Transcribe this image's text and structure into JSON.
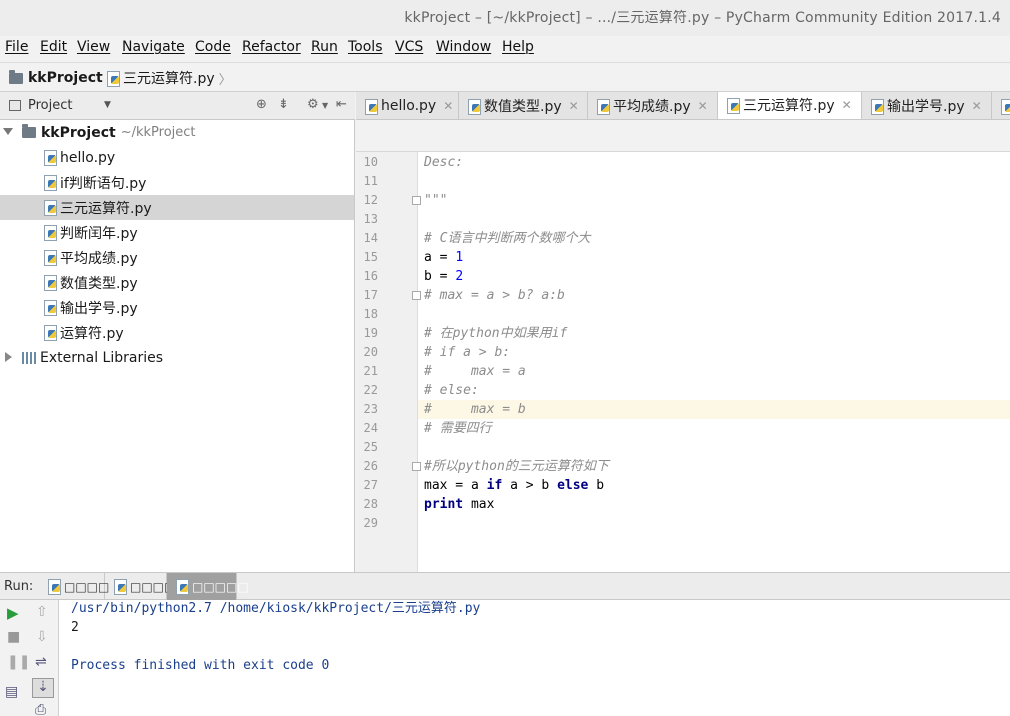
{
  "window": {
    "title": "kkProject – [~/kkProject] – .../三元运算符.py – PyCharm Community Edition 2017.1.4"
  },
  "menu": [
    "File",
    "Edit",
    "View",
    "Navigate",
    "Code",
    "Refactor",
    "Run",
    "Tools",
    "VCS",
    "Window",
    "Help"
  ],
  "breadcrumb": {
    "project": "kkProject",
    "file": "三元运算符.py"
  },
  "project_panel": {
    "title": "Project",
    "root": {
      "name": "kkProject",
      "path": "~/kkProject"
    },
    "files": [
      "hello.py",
      "if判断语句.py",
      "三元运算符.py",
      "判断闰年.py",
      "平均成绩.py",
      "数值类型.py",
      "输出学号.py",
      "运算符.py"
    ],
    "selected": "三元运算符.py",
    "external": "External Libraries"
  },
  "tabs": [
    "hello.py",
    "数值类型.py",
    "平均成绩.py",
    "三元运算符.py",
    "输出学号.py"
  ],
  "active_tab": "三元运算符.py",
  "editor": {
    "current_line": 23,
    "lines": [
      {
        "n": "10",
        "text": "Desc:"
      },
      {
        "n": "11",
        "text": ""
      },
      {
        "n": "12",
        "text": "\"\"\""
      },
      {
        "n": "13",
        "text": ""
      },
      {
        "n": "14",
        "text": "# C语言中判断两个数哪个大"
      },
      {
        "n": "15",
        "a": "a = ",
        "b": "1"
      },
      {
        "n": "16",
        "a": "b = ",
        "b": "2"
      },
      {
        "n": "17",
        "text": "# max = a > b? a:b"
      },
      {
        "n": "18",
        "text": ""
      },
      {
        "n": "19",
        "text": "# 在python中如果用if"
      },
      {
        "n": "20",
        "text": "# if a > b:"
      },
      {
        "n": "21",
        "text": "#     max = a"
      },
      {
        "n": "22",
        "text": "# else:"
      },
      {
        "n": "23",
        "text": "#     max = b"
      },
      {
        "n": "24",
        "text": "# 需要四行"
      },
      {
        "n": "25",
        "text": ""
      },
      {
        "n": "26",
        "text": "#所以python的三元运算符如下"
      },
      {
        "n": "27",
        "p1": "max = a ",
        "k1": "if",
        "p2": " a > b ",
        "k2": "else",
        "p3": " b"
      },
      {
        "n": "28",
        "k1": "print",
        "p1": " max"
      },
      {
        "n": "29",
        "text": ""
      }
    ]
  },
  "run": {
    "label": "Run:",
    "tabs": [
      "□□□□",
      "□□□□",
      "□□□□□"
    ],
    "console": [
      "/usr/bin/python2.7 /home/kiosk/kkProject/三元运算符.py",
      "2",
      "",
      "Process finished with exit code 0"
    ]
  }
}
